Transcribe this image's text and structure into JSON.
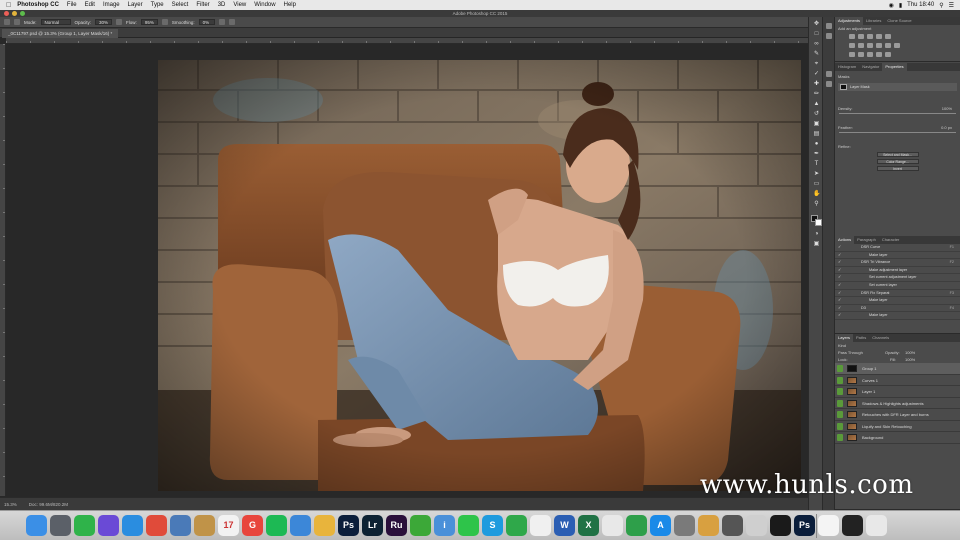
{
  "menubar": {
    "apple_icon": "apple-icon",
    "items": [
      "Photoshop CC",
      "File",
      "Edit",
      "Image",
      "Layer",
      "Type",
      "Select",
      "Filter",
      "3D",
      "View",
      "Window",
      "Help"
    ],
    "clock": "Thu 18:40"
  },
  "titlebar": {
    "title": "Adobe Photoshop CC 2015"
  },
  "options_bar": {
    "mode_label": "Mode:",
    "mode_value": "Normal",
    "opacity_label": "Opacity:",
    "opacity_value": "30%",
    "flow_label": "Flow:",
    "flow_value": "95%",
    "smoothing_label": "Smoothing:",
    "smoothing_value": "0%"
  },
  "document": {
    "tab_title": "_0C11797.psd @ 15.3% (Group 1, Layer Mask/16) *",
    "zoom": "15.3%",
    "doc_size": "Doc: 99.6M/820.2M"
  },
  "panels": {
    "top_tabs": [
      "Adjustments",
      "Libraries",
      "Clone Source"
    ],
    "add_adjustment": "Add an adjustment",
    "mid_tabs": [
      "Histogram",
      "Navigator",
      "Properties"
    ],
    "properties_title": "Masks",
    "layer_mask": "Layer Mask",
    "density_label": "Density:",
    "density_value": "100%",
    "feather_label": "Feather:",
    "feather_value": "0.0 px",
    "refine_label": "Refine:",
    "select_and_mask": "Select and Mask...",
    "color_range": "Color Range...",
    "invert": "Invert",
    "actions_tabs": [
      "Actions",
      "Paragraph",
      "Character"
    ],
    "actions": [
      {
        "label": "DSR Curve",
        "key": "F1"
      },
      {
        "label": "Make layer",
        "key": ""
      },
      {
        "label": "DSR Tri Vibrance",
        "key": "F2"
      },
      {
        "label": "Make adjustment layer",
        "key": ""
      },
      {
        "label": "Set current adjustment layer",
        "key": ""
      },
      {
        "label": "Set current layer",
        "key": ""
      },
      {
        "label": "DSR Fix Separat",
        "key": "F3"
      },
      {
        "label": "Make layer",
        "key": ""
      },
      {
        "label": "D3",
        "key": "F4"
      },
      {
        "label": "Make layer",
        "key": ""
      }
    ],
    "layers_tabs": [
      "Layers",
      "Paths",
      "Channels"
    ],
    "kind_label": "Kind",
    "blend_mode": "Pass Through",
    "layer_opacity_label": "Opacity:",
    "layer_opacity_value": "100%",
    "lock_label": "Lock:",
    "fill_label": "Fill:",
    "fill_value": "100%",
    "layers": [
      {
        "name": "Group 1",
        "sel": true
      },
      {
        "name": "Curves 1",
        "sel": false
      },
      {
        "name": "Layer 1",
        "sel": false
      },
      {
        "name": "Shadows & Highlights adjustments",
        "sel": false
      },
      {
        "name": "Retouches with DFR Layer and burns",
        "sel": false
      },
      {
        "name": "Liquify and Skin Retouching",
        "sel": false
      },
      {
        "name": "Background",
        "sel": false
      }
    ]
  },
  "watermark": "www.hunls.com",
  "dock": {
    "apps": [
      {
        "name": "finder",
        "label": "",
        "color": "#3b8fe6"
      },
      {
        "name": "launchpad",
        "label": "",
        "color": "#5b6068"
      },
      {
        "name": "evernote",
        "label": "",
        "color": "#2fb34a"
      },
      {
        "name": "siri",
        "label": "",
        "color": "#6a4ad6"
      },
      {
        "name": "safari",
        "label": "",
        "color": "#2a8de0"
      },
      {
        "name": "chrome",
        "label": "",
        "color": "#e04b3a"
      },
      {
        "name": "preview",
        "label": "",
        "color": "#4a7ab8"
      },
      {
        "name": "notes",
        "label": "",
        "color": "#c09348"
      },
      {
        "name": "calendar",
        "label": "17",
        "color": "#f2f2f2"
      },
      {
        "name": "google",
        "label": "G",
        "color": "#e8453c"
      },
      {
        "name": "spotify",
        "label": "",
        "color": "#1db954"
      },
      {
        "name": "keynote",
        "label": "",
        "color": "#3c87d8"
      },
      {
        "name": "photos",
        "label": "",
        "color": "#e8b43c"
      },
      {
        "name": "photoshop",
        "label": "Ps",
        "color": "#0b1e3b"
      },
      {
        "name": "lightroom",
        "label": "Lr",
        "color": "#0d2233"
      },
      {
        "name": "premiere-rush",
        "label": "Ru",
        "color": "#2a0f3b"
      },
      {
        "name": "camtasia",
        "label": "",
        "color": "#3ca838"
      },
      {
        "name": "info",
        "label": "i",
        "color": "#4a90d9"
      },
      {
        "name": "messages",
        "label": "",
        "color": "#2ec44a"
      },
      {
        "name": "skype",
        "label": "S",
        "color": "#1e9bde"
      },
      {
        "name": "facetime",
        "label": "",
        "color": "#2fa84a"
      },
      {
        "name": "pages",
        "label": "",
        "color": "#f0f0f0"
      },
      {
        "name": "word",
        "label": "W",
        "color": "#2b5eb3"
      },
      {
        "name": "excel",
        "label": "X",
        "color": "#207245"
      },
      {
        "name": "textedit",
        "label": "",
        "color": "#e8e8e8"
      },
      {
        "name": "numbers",
        "label": "",
        "color": "#2e9f4a"
      },
      {
        "name": "app-store",
        "label": "A",
        "color": "#1a8ae8"
      },
      {
        "name": "system-preferences",
        "label": "",
        "color": "#7a7a7a"
      },
      {
        "name": "notebook",
        "label": "",
        "color": "#d8a040"
      },
      {
        "name": "printer",
        "label": "",
        "color": "#555555"
      },
      {
        "name": "compass",
        "label": "",
        "color": "#cfcfcf"
      },
      {
        "name": "davinci",
        "label": "",
        "color": "#1a1a1a"
      },
      {
        "name": "photoshop-2",
        "label": "Ps",
        "color": "#0b1e3b"
      },
      {
        "name": "document",
        "label": "",
        "color": "#f4f4f4"
      },
      {
        "name": "screen",
        "label": "",
        "color": "#222222"
      },
      {
        "name": "trash",
        "label": "",
        "color": "#e8e8e8"
      }
    ]
  }
}
